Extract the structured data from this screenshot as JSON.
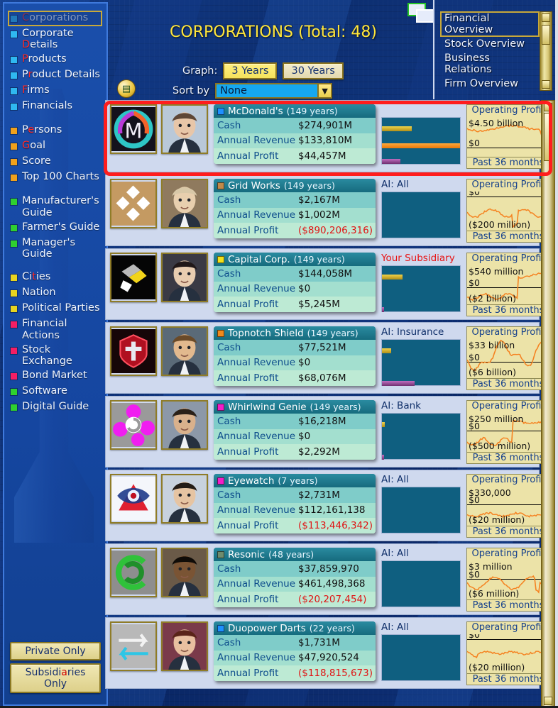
{
  "window": {
    "restore_icon": "window-restore-icon"
  },
  "header": {
    "title": "CORPORATIONS (Total: 48)",
    "graph_label": "Graph:",
    "graph_options": [
      "3 Years",
      "30 Years"
    ],
    "graph_selected": "3 Years",
    "sort_label": "Sort by",
    "sort_value": "None",
    "sort_arrow": "▼",
    "map_icon": "map-icon"
  },
  "sidebar": {
    "items": [
      {
        "label": "Corporations",
        "hk": "C",
        "bullet": "#2fb8f0",
        "selected": true
      },
      {
        "label": "Corporate Details",
        "hk": "D",
        "bullet": "#2fb8f0",
        "selected": false
      },
      {
        "label": "Products",
        "hk": "P",
        "bullet": "#2fb8f0",
        "selected": false
      },
      {
        "label": "Product Details",
        "hk": "r",
        "bullet": "#2fb8f0",
        "selected": false
      },
      {
        "label": "Firms",
        "hk": "F",
        "bullet": "#2fb8f0",
        "selected": false
      },
      {
        "label": "Financials",
        "hk": "",
        "bullet": "#2fb8f0",
        "selected": false
      },
      {
        "gap": true
      },
      {
        "label": "Persons",
        "hk": "e",
        "bullet": "#f0a11c",
        "selected": false
      },
      {
        "label": "Goal",
        "hk": "G",
        "bullet": "#f0a11c",
        "selected": false
      },
      {
        "label": "Score",
        "hk": "",
        "bullet": "#f0a11c",
        "selected": false
      },
      {
        "label": "Top 100 Charts",
        "hk": "",
        "bullet": "#f0a11c",
        "selected": false
      },
      {
        "gap": true
      },
      {
        "label": "Manufacturer's Guide",
        "hk": "",
        "bullet": "#2fd02f",
        "selected": false
      },
      {
        "label": "Farmer's Guide",
        "hk": "",
        "bullet": "#2fd02f",
        "selected": false
      },
      {
        "label": "Manager's Guide",
        "hk": "",
        "bullet": "#2fd02f",
        "selected": false
      },
      {
        "gap": true
      },
      {
        "label": "Cities",
        "hk": "t",
        "bullet": "#e8d41e",
        "selected": false
      },
      {
        "label": "Nation",
        "hk": "",
        "bullet": "#e8d41e",
        "selected": false
      },
      {
        "label": "Political Parties",
        "hk": "",
        "bullet": "#e8d41e",
        "selected": false
      },
      {
        "label": "Financial Actions",
        "hk": "",
        "bullet": "#f41e64",
        "selected": false
      },
      {
        "label": "Stock Exchange",
        "hk": "",
        "bullet": "#f41e64",
        "selected": false
      },
      {
        "label": "Bond Market",
        "hk": "",
        "bullet": "#f41e64",
        "selected": false
      },
      {
        "label": "Software",
        "hk": "",
        "bullet": "#2fd02f",
        "selected": false
      },
      {
        "label": "Digital Guide",
        "hk": "",
        "bullet": "#2fd02f",
        "selected": false
      }
    ],
    "buttons": [
      {
        "label": "Private Only",
        "hk": ""
      },
      {
        "label": "Subsidiaries Only",
        "hk": "a"
      }
    ]
  },
  "right_panel": {
    "items": [
      {
        "label": "Financial Overview",
        "selected": true
      },
      {
        "label": "Stock Overview",
        "selected": false
      },
      {
        "label": "Business Relations",
        "selected": false
      },
      {
        "label": "Firm Overview",
        "selected": false
      }
    ]
  },
  "list": {
    "field_labels": {
      "cash": "Cash",
      "revenue": "Annual Revenue",
      "profit": "Annual Profit"
    },
    "graph_title": "Operating Profit",
    "graph_footer": "Past 36 months",
    "rows": [
      {
        "name": "McDonald's",
        "years": "(149 years)",
        "swatch": "#1e90ff",
        "cash": "$274,901M",
        "revenue": "$133,810M",
        "profit": "$44,457M",
        "profit_negative": false,
        "ai": "",
        "subsidiary": false,
        "bars": [
          38,
          100,
          24
        ],
        "graph_top": "$4.50 billion",
        "graph_zero": "$0",
        "graph_bottom": "",
        "highlighted": true
      },
      {
        "name": "Grid Works",
        "years": "(149 years)",
        "swatch": "#c08a4a",
        "cash": "$2,167M",
        "revenue": "$1,002M",
        "profit": "($890,206,316)",
        "profit_negative": true,
        "ai": "AI: All",
        "subsidiary": false,
        "bars": [
          0,
          0,
          0
        ],
        "graph_top": "",
        "graph_zero": "$0",
        "graph_bottom": "($200 million)",
        "highlighted": false
      },
      {
        "name": "Capital Corp.",
        "years": "(149 years)",
        "swatch": "#f2e11c",
        "cash": "$144,058M",
        "revenue": "$0",
        "profit": "$5,245M",
        "profit_negative": false,
        "ai": "Your Subsidiary",
        "subsidiary": true,
        "bars": [
          26,
          0,
          3
        ],
        "graph_top": "$540 million",
        "graph_zero": "$0",
        "graph_bottom": "($2 billion)",
        "highlighted": false
      },
      {
        "name": "Topnotch Shield",
        "years": "(149 years)",
        "swatch": "#f08a1c",
        "cash": "$77,521M",
        "revenue": "$0",
        "profit": "$68,076M",
        "profit_negative": false,
        "ai": "AI: Insurance",
        "subsidiary": false,
        "bars": [
          12,
          0,
          42
        ],
        "graph_top": "$33 billion",
        "graph_zero": "$0",
        "graph_bottom": "($6 billion)",
        "highlighted": false
      },
      {
        "name": "Whirlwind Genie",
        "years": "(149 years)",
        "swatch": "#f41ec8",
        "cash": "$16,218M",
        "revenue": "$0",
        "profit": "$2,292M",
        "profit_negative": false,
        "ai": "AI: Bank",
        "subsidiary": false,
        "bars": [
          4,
          0,
          3
        ],
        "graph_top": "$250 million",
        "graph_zero": "$0",
        "graph_bottom": "($500 million)",
        "highlighted": false
      },
      {
        "name": "Eyewatch",
        "years": "(7 years)",
        "swatch": "#f41ec8",
        "cash": "$2,731M",
        "revenue": "$112,161,138",
        "profit": "($113,446,342)",
        "profit_negative": true,
        "ai": "AI: All",
        "subsidiary": false,
        "bars": [
          0,
          0,
          0
        ],
        "graph_top": "$330,000",
        "graph_zero": "$0",
        "graph_bottom": "($20 million)",
        "highlighted": false
      },
      {
        "name": "Resonic",
        "years": "(48 years)",
        "swatch": "#6e8c6e",
        "cash": "$37,859,970",
        "revenue": "$461,498,368",
        "profit": "($20,207,454)",
        "profit_negative": true,
        "ai": "AI: All",
        "subsidiary": false,
        "bars": [
          0,
          0,
          0
        ],
        "graph_top": "$3 million",
        "graph_zero": "$0",
        "graph_bottom": "($6 million)",
        "highlighted": false
      },
      {
        "name": "Duopower Darts",
        "years": "(22 years)",
        "swatch": "#1e90ff",
        "cash": "$1,731M",
        "revenue": "$47,920,524",
        "profit": "($118,815,673)",
        "profit_negative": true,
        "ai": "AI: All",
        "subsidiary": false,
        "bars": [
          0,
          0,
          0
        ],
        "graph_top": "",
        "graph_zero": "$0",
        "graph_bottom": "($20 million)",
        "highlighted": false
      }
    ]
  },
  "colors": {
    "accent_gold": "#c7a83a",
    "title_yellow": "#ffe53a",
    "negative_red": "#e01414",
    "highlight_red": "#ff1d1d",
    "graph_line": "#f58220"
  }
}
